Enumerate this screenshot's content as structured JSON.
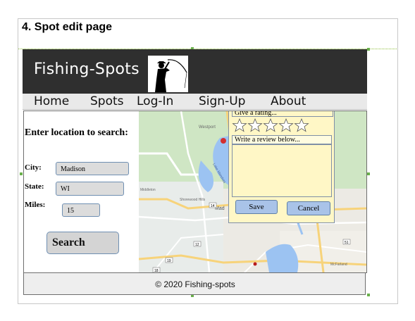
{
  "doc": {
    "heading": "4. Spot edit page"
  },
  "header": {
    "brand": "Fishing-Spots",
    "logo_icon": "fisherman-icon"
  },
  "nav": {
    "items": [
      "Home",
      "Spots",
      "Log-In",
      "Sign-Up",
      "About"
    ]
  },
  "search_panel": {
    "title": "Enter location to search:",
    "city_label": "City:",
    "city_value": "Madison",
    "state_label": "State:",
    "state_value": "WI",
    "miles_label": "Miles:",
    "miles_value": "15",
    "search_button": "Search"
  },
  "map": {
    "labels": [
      "Westport",
      "Lake Mendota",
      "Middleton",
      "Shorewood Hills",
      "Mad",
      "McFarland"
    ],
    "road_badges": [
      "19",
      "12",
      "14",
      "18",
      "51"
    ],
    "colors": {
      "land": "#cfe6c4",
      "water": "#9cc3f2",
      "road": "#f7d37a",
      "marker": "#d32f2f"
    }
  },
  "review_popup": {
    "rating_label": "Give a rating...",
    "rating_value": 0,
    "rating_max": 5,
    "review_placeholder": "Write a review below...",
    "save_button": "Save",
    "cancel_button": "Cancel",
    "bg_color": "#fff7c6"
  },
  "footer": {
    "text": "© 2020 Fishing-spots"
  }
}
